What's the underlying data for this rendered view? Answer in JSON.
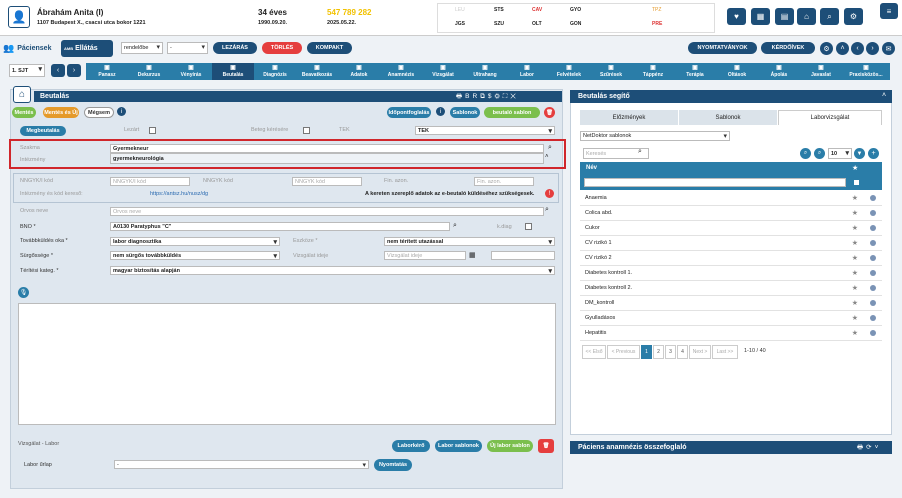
{
  "patient": {
    "name": "Ábrahám Anita (I)",
    "address": "1107 Budapest X., csacsi utca bokor 1221",
    "age": "34 éves",
    "birth_date": "1990.09.20.",
    "phone": "547 789 282",
    "visit_date": "2025.05.22."
  },
  "lab_grid": [
    [
      "LEU",
      "STS",
      "CAV",
      "GYO",
      "TPZ"
    ],
    [
      "JGS",
      "SZU",
      "OLT",
      "GON",
      "PRE"
    ]
  ],
  "nav": {
    "patients_label": "Páciensek",
    "care_label": "Ellátás",
    "amb_badge": "AMB",
    "order_select": "rendelőbe",
    "second_select": "-",
    "close_button": "LEZÁRÁS",
    "delete_button": "TÖRLÉS",
    "compact_button": "KOMPAKT",
    "print_button": "NYOMTATVÁNYOK",
    "questionnaire_button": "KÉRDŐÍVEK"
  },
  "module_select": "1. SJT",
  "tabs": [
    "Panasz",
    "Dekurzus",
    "Vényírás",
    "Beutalás",
    "Diagnózis",
    "Beavatkozás",
    "Adatok",
    "Anamnézis",
    "Vizsgálat",
    "Ultrahang",
    "Labor",
    "Felvételek",
    "Szűrések",
    "Táppénz",
    "Terápia",
    "Oltások",
    "Ápolás",
    "Javaslat",
    "Praxisközös..."
  ],
  "referral": {
    "title": "Beutalás",
    "new_button": "Mentés",
    "new_copy_button": "Mentés és Új",
    "cancel_button": "Mégsem",
    "eeszt_button": "Időpontfoglalás",
    "templates_button": "Sablonok",
    "save_template_button": "beutaló sablon",
    "send_button": "Megbeutalás",
    "label_lezart": "Lezárt",
    "label_beteg_kereso": "Beteg kérésére",
    "label_tek": "TEK",
    "tek_value": "TEK",
    "label_szakma": "Szakma",
    "szakma_value": "Gyermekneur",
    "szakma_suggestion": "gyermekneurológia",
    "label_intezmeny": "Intézmény",
    "label_nngyk": "NNGYK/I kód",
    "nngyk_placeholder": "NNGYK/I kód",
    "label_nngyk2": "NNGYK kód",
    "nngyk2_placeholder": "NNGYK kód",
    "label_fin_azon": "Fin. azon.",
    "fin_azon_placeholder": "Fin. azon.",
    "label_intezmeny_kereso": "Intézmény és kód kereső:",
    "intezmeny_link": "https://antsz.hu/nusz/dg",
    "ebeutalo_note": "A kereten szereplő adatok az e-beutaló küldéséhez szükségesek.",
    "label_orvos": "Orvos neve",
    "orvos_placeholder": "Orvos neve",
    "label_bno": "BNO *",
    "bno_value": "A0130 Paratyphus \"C\"",
    "label_kdiag": "k.diag",
    "label_tovkuldes": "Továbbküldés oka *",
    "tovkuldes_value": "labor diagnosztika",
    "label_eszkoze": "Eszköze *",
    "eszkoze_value": "nem térített utazással",
    "label_surgosseg": "Sürgőssége *",
    "surgosseg_value": "nem sürgős továbbküldés",
    "label_vizsgalat_ideje": "Vizsgálat ideje",
    "vizsgalat_placeholder": "Vizsgálat ideje",
    "label_teritesi": "Térítési kateg. *",
    "teritesi_value": "magyar biztosítás alapján"
  },
  "lab_section": {
    "title": "Vizsgálat - Labor",
    "labor_kero_button": "Laborkérő",
    "labor_sablonok_button": "Labor sablonok",
    "uj_labor_sablon_button": "Új labor sablon",
    "label_urlap": "Labor űrlap",
    "urlap_value": "-",
    "print_button": "Nyomtatás"
  },
  "helper": {
    "title": "Beutalás segítő",
    "tabs": [
      "Előzmények",
      "Sablonok",
      "Laborvizsgálat"
    ],
    "source_select": "NetDoktor sablonok",
    "search_placeholder": "Keresés",
    "page_size": "10",
    "column_name": "Név",
    "items": [
      "Anaemia",
      "Colica abd.",
      "Cukor",
      "CV rizikó 1",
      "CV rizikó 2",
      "Diabetes kontroll 1.",
      "Diabetes kontroll 2.",
      "DM_kontroll",
      "Gyulladásos",
      "Hepatitis"
    ],
    "pager": [
      "<< Első",
      "< Previous",
      "1",
      "2",
      "3",
      "4",
      "Next >",
      "Last >>"
    ],
    "range": "1-10 / 40"
  },
  "anamnesis_panel_title": "Páciens anamnézis összefoglaló",
  "colors": {
    "primary": "#1d4e78",
    "tab": "#2a7da8",
    "highlight": "#d0262b",
    "green": "#7bbf4d",
    "orange": "#e59a2a",
    "red": "#e53e3e"
  }
}
